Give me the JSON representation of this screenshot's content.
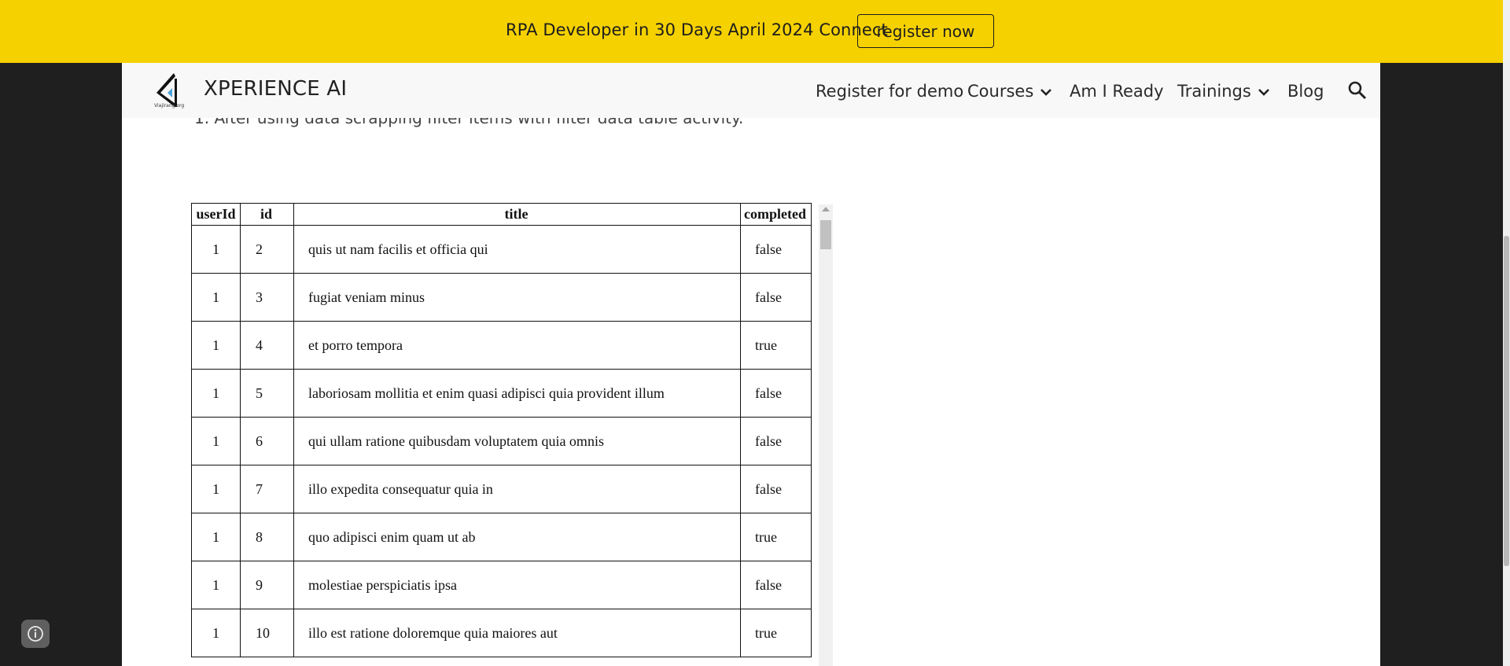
{
  "announcement": {
    "text": "RPA Developer in 30 Days April 2024 Connect",
    "button_label": "register now",
    "background": "#f5d100"
  },
  "header": {
    "site_title": "XPERIENCE AI",
    "logo_caption": "Viajirang.org",
    "nav": [
      {
        "label": "Register for demo"
      },
      {
        "label": "Courses",
        "has_dropdown": true
      },
      {
        "label": "Am I Ready"
      },
      {
        "label": "Trainings",
        "has_dropdown": true
      },
      {
        "label": "Blog"
      }
    ],
    "search_icon": "search-icon"
  },
  "content": {
    "intro": "1. After using data scrapping filter items with filter data table activity."
  },
  "table": {
    "columns": [
      "userId",
      "id",
      "title",
      "completed"
    ],
    "rows": [
      {
        "userId": "1",
        "id": "2",
        "title": "quis ut nam facilis et officia qui",
        "completed": "false"
      },
      {
        "userId": "1",
        "id": "3",
        "title": "fugiat veniam minus",
        "completed": "false"
      },
      {
        "userId": "1",
        "id": "4",
        "title": "et porro tempora",
        "completed": "true"
      },
      {
        "userId": "1",
        "id": "5",
        "title": "laboriosam mollitia et enim quasi adipisci quia provident illum",
        "completed": "false"
      },
      {
        "userId": "1",
        "id": "6",
        "title": "qui ullam ratione quibusdam voluptatem quia omnis",
        "completed": "false"
      },
      {
        "userId": "1",
        "id": "7",
        "title": "illo expedita consequatur quia in",
        "completed": "false"
      },
      {
        "userId": "1",
        "id": "8",
        "title": "quo adipisci enim quam ut ab",
        "completed": "true"
      },
      {
        "userId": "1",
        "id": "9",
        "title": "molestiae perspiciatis ipsa",
        "completed": "false"
      },
      {
        "userId": "1",
        "id": "10",
        "title": "illo est ratione doloremque quia maiores aut",
        "completed": "true"
      }
    ]
  },
  "footer": {
    "info_icon": "info-icon"
  }
}
